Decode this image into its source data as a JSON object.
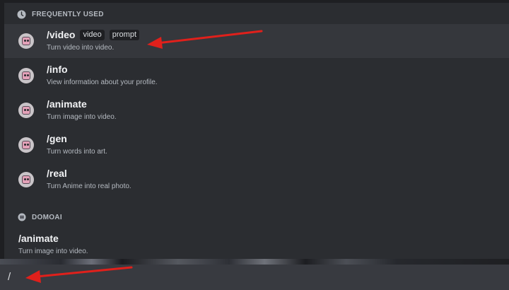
{
  "sections": {
    "frequently_used": {
      "title": "FREQUENTLY USED",
      "icon": "clock-icon"
    },
    "domoai": {
      "title": "DOMOAI",
      "icon": "bot-icon"
    }
  },
  "commands": [
    {
      "name": "/video",
      "options": [
        "video",
        "prompt"
      ],
      "description": "Turn video into video.",
      "selected": true
    },
    {
      "name": "/info",
      "options": [],
      "description": "View information about your profile.",
      "selected": false
    },
    {
      "name": "/animate",
      "options": [],
      "description": "Turn image into video.",
      "selected": false
    },
    {
      "name": "/gen",
      "options": [],
      "description": "Turn words into art.",
      "selected": false
    },
    {
      "name": "/real",
      "options": [],
      "description": "Turn Anime into real photo.",
      "selected": false
    }
  ],
  "domoai_command": {
    "name": "/animate",
    "description": "Turn image into video."
  },
  "input": {
    "value": "/"
  },
  "colors": {
    "panel": "#2b2d31",
    "selected_row": "#35373c",
    "input_bar": "#383a40",
    "annotation_arrow": "#e0201b"
  }
}
